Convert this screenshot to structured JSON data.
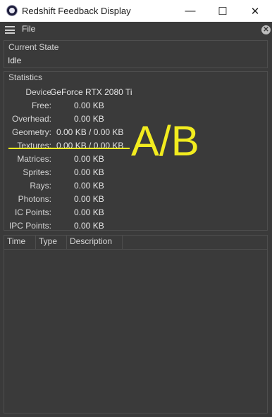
{
  "window": {
    "title": "Redshift Feedback Display",
    "minimize": "—",
    "maximize": "☐",
    "close": "✕"
  },
  "menu": {
    "file": "File",
    "close_symbol": "✕"
  },
  "current_state": {
    "title": "Current State",
    "value": "Idle"
  },
  "statistics": {
    "title": "Statistics",
    "rows": [
      {
        "label": "Device",
        "value": "GeForce RTX 2080 Ti"
      },
      {
        "label": "Free:",
        "value": "0.00 KB"
      },
      {
        "label": "Overhead:",
        "value": "0.00 KB"
      },
      {
        "label": "Geometry:",
        "value": "0.00 KB / 0.00 KB"
      },
      {
        "label": "Textures:",
        "value": "0.00 KB / 0.00 KB"
      },
      {
        "label": "Matrices:",
        "value": "0.00 KB"
      },
      {
        "label": "Sprites:",
        "value": "0.00 KB"
      },
      {
        "label": "Rays:",
        "value": "0.00 KB"
      },
      {
        "label": "Photons:",
        "value": "0.00 KB"
      },
      {
        "label": "IC Points:",
        "value": "0.00 KB"
      },
      {
        "label": "IPC Points:",
        "value": "0.00 KB"
      }
    ]
  },
  "log": {
    "columns": [
      "Time",
      "Type",
      "Description"
    ]
  },
  "annotation": {
    "text": "A/B",
    "color": "#f2ec1f"
  }
}
